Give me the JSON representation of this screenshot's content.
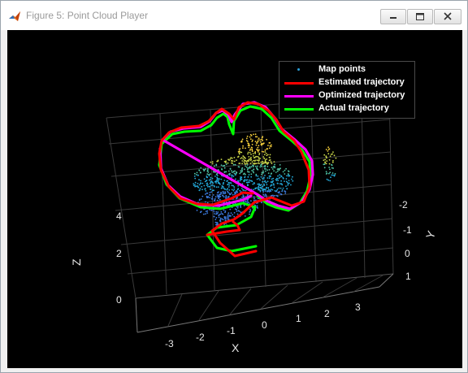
{
  "window": {
    "title": "Figure 5: Point Cloud Player",
    "icon": "matlab-icon",
    "controls": [
      "minimize-icon",
      "maximize-icon",
      "close-icon"
    ]
  },
  "legend": {
    "items": [
      {
        "label": "Map points",
        "color": "#2a9fd8",
        "marker": "dot"
      },
      {
        "label": "Estimated trajectory",
        "color": "#ff0000",
        "marker": "line"
      },
      {
        "label": "Optimized trajectory",
        "color": "#ff00ff",
        "marker": "line"
      },
      {
        "label": "Actual trajectory",
        "color": "#00ff00",
        "marker": "line"
      }
    ]
  },
  "axes": {
    "x": {
      "label": "X",
      "ticks": [
        "-3",
        "-2",
        "-1",
        "0",
        "1",
        "2",
        "3"
      ]
    },
    "y": {
      "label": "Y",
      "ticks": [
        "-2",
        "-1",
        "0",
        "1"
      ]
    },
    "z": {
      "label": "Z",
      "ticks": [
        "0",
        "2",
        "4"
      ]
    }
  },
  "colors": {
    "background": "#000000",
    "grid": "#3a3a3a",
    "estimated": "#ff0000",
    "optimized": "#ff00ff",
    "actual": "#00ff00"
  }
}
